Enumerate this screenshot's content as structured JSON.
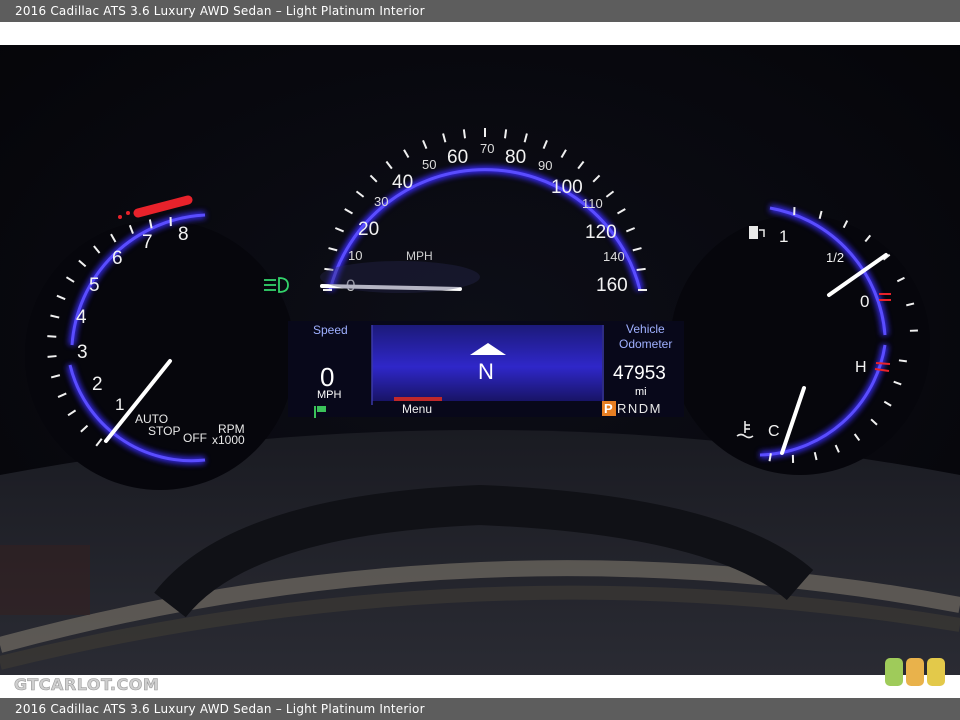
{
  "caption": "2016 Cadillac ATS 3.6 Luxury AWD Sedan – Light Platinum Interior",
  "watermark": "GTCARLOT.COM",
  "tachometer": {
    "tick_labels": [
      "1",
      "2",
      "3",
      "4",
      "5",
      "6",
      "7",
      "8"
    ],
    "rpm_label": "RPM",
    "multiplier_label": "x1000",
    "auto_stop_line1": "AUTO",
    "auto_stop_line2": "STOP",
    "off_label": "OFF"
  },
  "speedometer": {
    "major_labels": [
      "0",
      "20",
      "40",
      "60",
      "80",
      "100",
      "120",
      "160"
    ],
    "minor_labels": [
      "10",
      "30",
      "50",
      "70",
      "90",
      "110",
      "140"
    ],
    "unit": "MPH"
  },
  "info_display": {
    "speed_title": "Speed",
    "speed_value": "0",
    "speed_unit": "MPH",
    "heading": "N",
    "menu_label": "Menu",
    "odometer_line1": "Vehicle",
    "odometer_line2": "Odometer",
    "odometer_value": "47953",
    "odometer_unit": "mi",
    "gear_selected": "P",
    "gear_rest": "RNDM"
  },
  "fuel_gauge": {
    "labels": [
      "1",
      "1/2",
      "0"
    ]
  },
  "temp_gauge": {
    "hot_label": "H",
    "cold_label": "C"
  },
  "colors": {
    "arc_glow": "#3a2cff",
    "redline": "#e8222b",
    "gear_highlight": "#e67e22"
  }
}
